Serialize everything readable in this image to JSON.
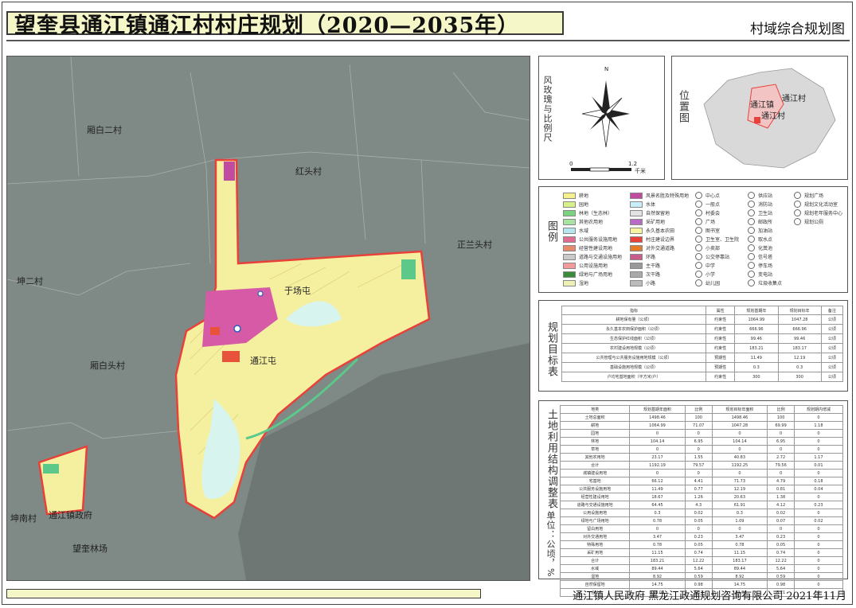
{
  "header": {
    "title": "望奎县通江镇通江村村庄规划（2020—2035年）",
    "subtitle": "村域综合规划图"
  },
  "map": {
    "place_labels": {
      "xiangbai2": "厢白二村",
      "hongtou": "红头村",
      "zhenglantou": "正兰头村",
      "kun2": "坤二村",
      "xiangbaitou": "厢白头村",
      "yuchangtun": "于场屯",
      "tongjiangtun": "通江屯",
      "kunnan": "坤南村",
      "town_gov": "通江镇政府",
      "forest_farm": "望奎林场"
    },
    "colors": {
      "background": "#7f8985",
      "village_land": "#f5f0a0",
      "boundary": "#e8413a",
      "settlement": "#d65aa6",
      "water": "#d8f4ef",
      "green": "#5cc98a"
    }
  },
  "compass": {
    "label": "风玫瑰与比例尺",
    "north": "N",
    "scale_start": "0",
    "scale_end": "1.2",
    "scale_unit": "千米"
  },
  "location_map": {
    "label": "位置图",
    "town_label": "通江镇",
    "village_label": "通江村",
    "village_label_2": "通江村"
  },
  "legend": {
    "label": "图例",
    "col1": [
      {
        "text": "耕地",
        "color": "#f5f08c"
      },
      {
        "text": "园地",
        "color": "#d7f08a"
      },
      {
        "text": "林地（生态林）",
        "color": "#79d37f"
      },
      {
        "text": "其他农用地",
        "color": "#a8e3a1"
      },
      {
        "text": "水域",
        "color": "#b5e6f0"
      },
      {
        "text": "公共服务设施用地",
        "color": "#e06c8f"
      },
      {
        "text": "经营性建设用地",
        "color": "#e58a6a"
      },
      {
        "text": "道路与交通设施用地",
        "color": "#c9c9c9"
      },
      {
        "text": "公用设施用地",
        "color": "#f29b9b"
      },
      {
        "text": "绿地与广场用地",
        "color": "#3a8c3a"
      },
      {
        "text": "湿地",
        "color": "#eef0b4"
      }
    ],
    "col2": [
      {
        "text": "风景名胜及特殊用地",
        "color": "#c04ba0"
      },
      {
        "text": "水体",
        "color": "#c7eff5"
      },
      {
        "text": "自然保留地",
        "color": "#e3e3e3"
      },
      {
        "text": "采矿用地",
        "color": "#b86bc4"
      },
      {
        "text": "永久基本农田",
        "color": "#f7f2a0"
      },
      {
        "text": "村庄建设边界",
        "color": "#e8413a"
      },
      {
        "text": "对外交通道路",
        "color": "#e07b2b"
      },
      {
        "text": "环路",
        "color": "#c95c8a"
      },
      {
        "text": "主干路",
        "color": "#999999"
      },
      {
        "text": "次干路",
        "color": "#aaaaaa"
      },
      {
        "text": "小路",
        "color": "#bbbbbb"
      }
    ],
    "col3": [
      {
        "text": "中心点"
      },
      {
        "text": "一般点"
      },
      {
        "text": "村委会"
      },
      {
        "text": "广场"
      },
      {
        "text": "图书室"
      },
      {
        "text": "卫生室、卫生院"
      },
      {
        "text": "小卖部"
      },
      {
        "text": "公交停靠站"
      },
      {
        "text": "中学"
      },
      {
        "text": "小学"
      },
      {
        "text": "幼儿园"
      }
    ],
    "col4": [
      {
        "text": "供应站"
      },
      {
        "text": "消防站"
      },
      {
        "text": "卫生站"
      },
      {
        "text": "邮政所"
      },
      {
        "text": "加油站"
      },
      {
        "text": "取水点"
      },
      {
        "text": "化粪池"
      },
      {
        "text": "信号塔"
      },
      {
        "text": "停车场"
      },
      {
        "text": "变电站"
      },
      {
        "text": "垃圾收集点"
      }
    ],
    "col5": [
      {
        "text": "规划广场"
      },
      {
        "text": "规划文化活动室"
      },
      {
        "text": "规划老年服务中心"
      },
      {
        "text": "规划公厕"
      }
    ]
  },
  "goals_table": {
    "label": "规划目标表",
    "headers": [
      "指标",
      "属性",
      "规划基期年",
      "规划目标年",
      "备注"
    ],
    "rows": [
      [
        "耕地保有量（公顷）",
        "约束性",
        "1064.99",
        "1047.28",
        "公顷"
      ],
      [
        "永久基本农田保护面积（公顷）",
        "约束性",
        "666.96",
        "666.96",
        "公顷"
      ],
      [
        "生态保护红线面积（公顷）",
        "约束性",
        "99.46",
        "99.46",
        "公顷"
      ],
      [
        "农村建设用地规模（公顷）",
        "约束性",
        "183.21",
        "183.17",
        "公顷"
      ],
      [
        "公共管理与公共服务设施用地规模（公顷）",
        "预期性",
        "11.49",
        "12.19",
        "公顷"
      ],
      [
        "基础设施用地规模（公顷）",
        "预期性",
        "0.3",
        "0.3",
        "公顷"
      ],
      [
        "户均宅基地面积（平方米/户）",
        "约束性",
        "300",
        "300",
        "公顷"
      ]
    ]
  },
  "landuse_table": {
    "label": "土地利用结构调整表",
    "unit": "单位：公顷，%",
    "headers": [
      "地类",
      "规划基期年面积",
      "比例",
      "规划目标年面积",
      "比例",
      "规划期内增减"
    ],
    "rows": [
      [
        "土地总面积",
        "1498.46",
        "100",
        "1498.46",
        "100",
        "0"
      ],
      [
        "耕地",
        "1064.99",
        "71.07",
        "1047.28",
        "69.99",
        "1.18"
      ],
      [
        "园地",
        "0",
        "0",
        "0",
        "0",
        "0"
      ],
      [
        "林地",
        "104.14",
        "6.95",
        "104.14",
        "6.95",
        "0"
      ],
      [
        "草地",
        "0",
        "0",
        "0",
        "0",
        "0"
      ],
      [
        "其他农用地",
        "23.17",
        "1.55",
        "40.83",
        "2.72",
        "1.17"
      ],
      [
        "合计",
        "1192.19",
        "79.57",
        "1192.25",
        "79.56",
        "0.01"
      ],
      [
        "城镇建设用地",
        "0",
        "0",
        "0",
        "0",
        "0"
      ],
      [
        "宅基地",
        "66.12",
        "4.41",
        "71.73",
        "4.79",
        "0.18"
      ],
      [
        "公共服务设施用地",
        "11.49",
        "0.77",
        "12.19",
        "0.81",
        "0.04"
      ],
      [
        "经营性建设用地",
        "18.67",
        "1.26",
        "20.63",
        "1.38",
        "0"
      ],
      [
        "道路与交通设施用地",
        "64.45",
        "4.3",
        "61.91",
        "4.12",
        "0.23"
      ],
      [
        "公用设施用地",
        "0.3",
        "0.02",
        "0.3",
        "0.02",
        "0"
      ],
      [
        "绿地与广场用地",
        "0.78",
        "0.05",
        "1.09",
        "0.07",
        "0.02"
      ],
      [
        "留白用地",
        "0",
        "0",
        "0",
        "0",
        "0"
      ],
      [
        "对外交通用地",
        "3.47",
        "0.23",
        "3.47",
        "0.23",
        "0"
      ],
      [
        "特殊用地",
        "0.78",
        "0.05",
        "0.78",
        "0.05",
        "0"
      ],
      [
        "采矿用地",
        "11.15",
        "0.74",
        "11.15",
        "0.74",
        "0"
      ],
      [
        "合计",
        "183.21",
        "12.22",
        "183.17",
        "12.22",
        "0"
      ],
      [
        "水域",
        "89.44",
        "5.64",
        "89.44",
        "5.64",
        "0"
      ],
      [
        "湿地",
        "8.92",
        "0.59",
        "8.92",
        "0.59",
        "0"
      ],
      [
        "自然保留地",
        "14.75",
        "0.98",
        "14.75",
        "0.98",
        "0"
      ],
      [
        "合计",
        "123.06",
        "8.21",
        "123.06",
        "8.21",
        "0"
      ]
    ]
  },
  "footer": {
    "text": "通江镇人民政府  黑龙江政通规划咨询有限公司  2021年11月"
  }
}
